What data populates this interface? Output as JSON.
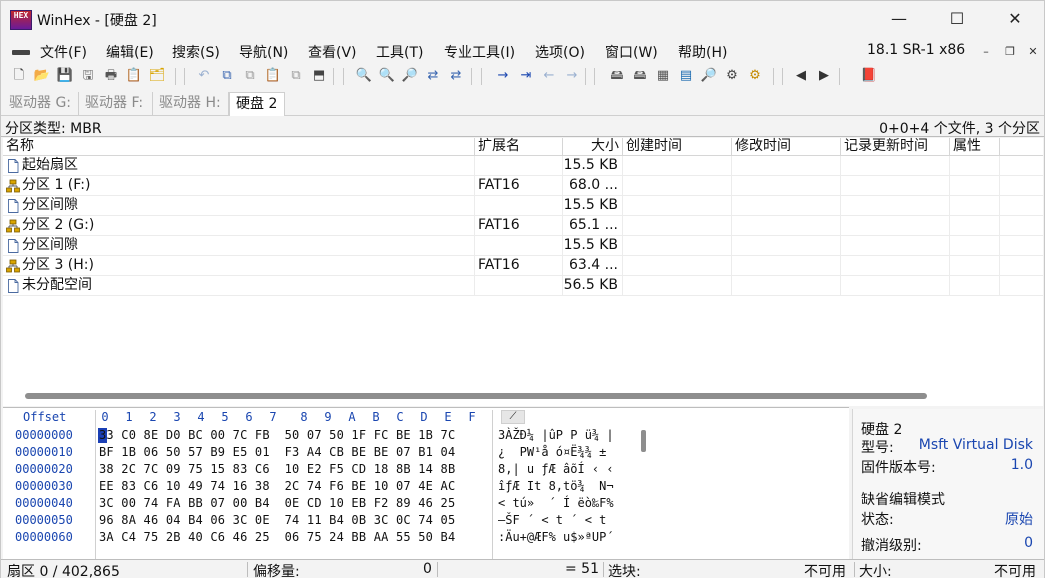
{
  "window": {
    "logo_text": "HEX",
    "title": "WinHex - [硬盘 2]",
    "minimize": "—",
    "maximize": "☐",
    "close": "✕"
  },
  "menu": {
    "items": [
      "文件(F)",
      "编辑(E)",
      "搜索(S)",
      "导航(N)",
      "查看(V)",
      "工具(T)",
      "专业工具(I)",
      "选项(O)",
      "窗口(W)",
      "帮助(H)"
    ],
    "version": "18.1 SR-1 x86",
    "mdi_min": "–",
    "mdi_restore": "❐",
    "mdi_close": "✕"
  },
  "toolbar": {
    "icons": [
      {
        "name": "new-file-icon",
        "glyph": "🗋",
        "color": "#444444"
      },
      {
        "name": "open-folder-icon",
        "glyph": "📂",
        "color": "#d9a400"
      },
      {
        "name": "save-icon",
        "glyph": "💾",
        "color": "#9a9a9a"
      },
      {
        "name": "save-all-icon",
        "glyph": "🖫",
        "color": "#666666"
      },
      {
        "name": "print-icon",
        "glyph": "🖶",
        "color": "#555555"
      },
      {
        "name": "properties-icon",
        "glyph": "📋",
        "color": "#555555"
      },
      {
        "name": "open-disk-icon",
        "glyph": "🗂",
        "color": "#d9a400"
      },
      {
        "name": "undo-icon",
        "glyph": "↶",
        "color": "#9ab0d0"
      },
      {
        "name": "copy-icon",
        "glyph": "⧉",
        "color": "#3a66b0"
      },
      {
        "name": "copy-block-icon",
        "glyph": "⧉",
        "color": "#9a9a9a"
      },
      {
        "name": "paste-icon",
        "glyph": "📋",
        "color": "#555555"
      },
      {
        "name": "paste-write-icon",
        "glyph": "⧉",
        "color": "#9a9a9a"
      },
      {
        "name": "hex-convert-icon",
        "glyph": "⬒",
        "color": "#444444"
      },
      {
        "name": "find-text-icon",
        "glyph": "🔍",
        "color": "#333333"
      },
      {
        "name": "find-hex-icon",
        "glyph": "🔍",
        "color": "#b0322a"
      },
      {
        "name": "find-hex-value-icon",
        "glyph": "🔎",
        "color": "#b0322a"
      },
      {
        "name": "replace-text-icon",
        "glyph": "⇄",
        "color": "#3a66b0"
      },
      {
        "name": "replace-hex-icon",
        "glyph": "⇄",
        "color": "#3a66b0"
      },
      {
        "name": "goto-offset-icon",
        "glyph": "→",
        "color": "#1a46b0"
      },
      {
        "name": "goto-sector-icon",
        "glyph": "⇥",
        "color": "#1a46b0"
      },
      {
        "name": "back-icon",
        "glyph": "←",
        "color": "#9ab0d0"
      },
      {
        "name": "forward-icon",
        "glyph": "→",
        "color": "#9ab0d0"
      },
      {
        "name": "open-drive-icon",
        "glyph": "🖴",
        "color": "#555555"
      },
      {
        "name": "disk-editor-icon",
        "glyph": "🖴",
        "color": "#555555"
      },
      {
        "name": "ram-editor-icon",
        "glyph": "▦",
        "color": "#555555"
      },
      {
        "name": "calculator-icon",
        "glyph": "▤",
        "color": "#1a6ab0"
      },
      {
        "name": "search-position-icon",
        "glyph": "🔎",
        "color": "#333333"
      },
      {
        "name": "tools-icon",
        "glyph": "⚙",
        "color": "#444444"
      },
      {
        "name": "settings-gear-icon",
        "glyph": "⚙",
        "color": "#c48a00"
      },
      {
        "name": "prev-window-icon",
        "glyph": "◀",
        "color": "#333333"
      },
      {
        "name": "next-window-icon",
        "glyph": "▶",
        "color": "#333333"
      },
      {
        "name": "help-book-icon",
        "glyph": "📕",
        "color": "#7a2a9a"
      }
    ]
  },
  "tabs": [
    {
      "label": "驱动器 G:",
      "active": false
    },
    {
      "label": "驱动器 F:",
      "active": false
    },
    {
      "label": "驱动器 H:",
      "active": false
    },
    {
      "label": "硬盘 2",
      "active": true
    }
  ],
  "partition_bar": {
    "left": "分区类型: MBR",
    "right": "0+0+4 个文件, 3 个分区"
  },
  "dir_table": {
    "columns": [
      "名称",
      "扩展名",
      "大小",
      "创建时间",
      "修改时间",
      "记录更新时间",
      "属性"
    ],
    "rows": [
      {
        "name": "起始扇区",
        "ext": "",
        "size": "15.5 KB",
        "icon": "file"
      },
      {
        "name": "分区 1 (F:)",
        "ext": "FAT16",
        "size": "68.0 ...",
        "icon": "partition"
      },
      {
        "name": "分区间隙",
        "ext": "",
        "size": "15.5 KB",
        "icon": "file"
      },
      {
        "name": "分区 2 (G:)",
        "ext": "FAT16",
        "size": "65.1 ...",
        "icon": "partition"
      },
      {
        "name": "分区间隙",
        "ext": "",
        "size": "15.5 KB",
        "icon": "file"
      },
      {
        "name": "分区 3 (H:)",
        "ext": "FAT16",
        "size": "63.4 ...",
        "icon": "partition"
      },
      {
        "name": "未分配空间",
        "ext": "",
        "size": "56.5 KB",
        "icon": "file"
      }
    ]
  },
  "hex": {
    "offset_label": "Offset",
    "col_labels": [
      "0",
      "1",
      "2",
      "3",
      "4",
      "5",
      "6",
      "7",
      "8",
      "9",
      "A",
      "B",
      "C",
      "D",
      "E",
      "F"
    ],
    "ascii_header": "⟋",
    "lines": [
      {
        "offset": "00000000",
        "bytes": "33 C0 8E D0 BC 00 7C FB  50 07 50 1F FC BE 1B 7C",
        "ascii": "3ÀŽĐ¼ |ûP P ü¾ |"
      },
      {
        "offset": "00000010",
        "bytes": "BF 1B 06 50 57 B9 E5 01  F3 A4 CB BE BE 07 B1 04",
        "ascii": "¿  PW¹å ó¤Ë¾¾ ±"
      },
      {
        "offset": "00000020",
        "bytes": "38 2C 7C 09 75 15 83 C6  10 E2 F5 CD 18 8B 14 8B",
        "ascii": "8,| u ƒÆ âõÍ ‹ ‹"
      },
      {
        "offset": "00000030",
        "bytes": "EE 83 C6 10 49 74 16 38  2C 74 F6 BE 10 07 4E AC",
        "ascii": "îƒÆ It 8,tö¾  N¬"
      },
      {
        "offset": "00000040",
        "bytes": "3C 00 74 FA BB 07 00 B4  0E CD 10 EB F2 89 46 25",
        "ascii": "< tú»  ´ Í ëò‰F%"
      },
      {
        "offset": "00000050",
        "bytes": "96 8A 46 04 B4 06 3C 0E  74 11 B4 0B 3C 0C 74 05",
        "ascii": "–ŠF ´ < t ´ < t"
      },
      {
        "offset": "00000060",
        "bytes": "3A C4 75 2B 40 C6 46 25  06 75 24 BB AA 55 50 B4",
        "ascii": ":Äu+@ÆF% u$»ªUP´"
      }
    ]
  },
  "info_panel": {
    "title": "硬盘 2",
    "rows": [
      {
        "key": "型号:",
        "value": "Msft Virtual Disk"
      },
      {
        "key": "固件版本号:",
        "value": "1.0"
      },
      {
        "key": "缺省编辑模式",
        "value": ""
      },
      {
        "key": "状态:",
        "value": "原始"
      },
      {
        "key": "撤消级别:",
        "value": "0"
      }
    ]
  },
  "status": {
    "sector": "扇区 0 / 402,865",
    "offset_label": "偏移量:",
    "offset_value": "0",
    "value_equals": "= 51",
    "block_label": "选块:",
    "block_value": "不可用",
    "size_label": "大小:",
    "size_value": "不可用"
  },
  "colors": {
    "hex_blue": "#1a46b0",
    "cursor": "#1a3fb5",
    "partition_icon": "#d9a400"
  }
}
